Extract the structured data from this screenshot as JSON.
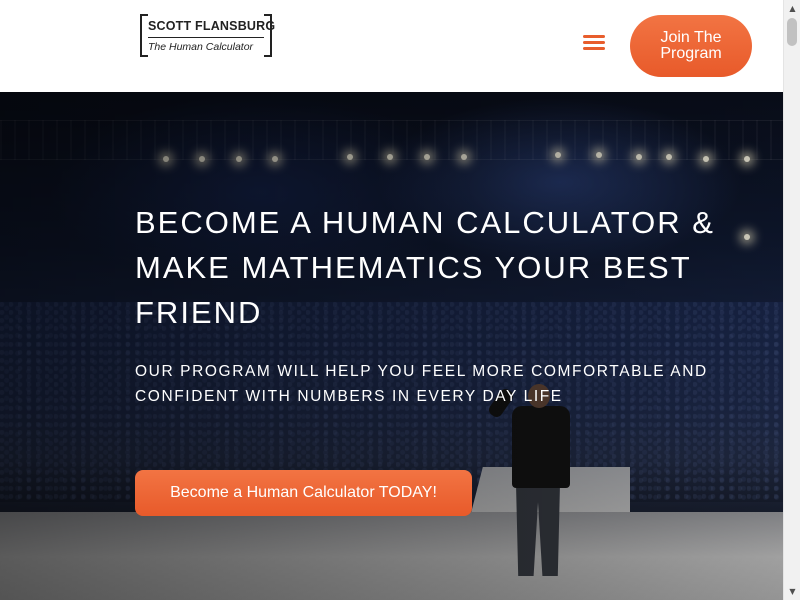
{
  "header": {
    "logo": {
      "name": "SCOTT FLANSBURG",
      "tagline": "The Human Calculator"
    },
    "menu_icon": "hamburger-menu-icon",
    "join_button_label": "Join The Program"
  },
  "hero": {
    "title": "BECOME A HUMAN CALCULATOR & MAKE MATHEMATICS YOUR BEST FRIEND",
    "subtitle": "OUR PROGRAM WILL HELP YOU FEEL MORE COMFORTABLE AND CONFIDENT WITH NUMBERS IN EVERY DAY LIFE",
    "cta_label": "Become a Human Calculator TODAY!",
    "background_image": "arena stage with speaker and audience"
  },
  "colors": {
    "accent": "#e85d2c",
    "accent_light": "#f27443",
    "text_on_dark": "#ffffff"
  },
  "scrollbar": {
    "up_icon": "scroll-up-arrow-icon",
    "down_icon": "scroll-down-arrow-icon"
  }
}
